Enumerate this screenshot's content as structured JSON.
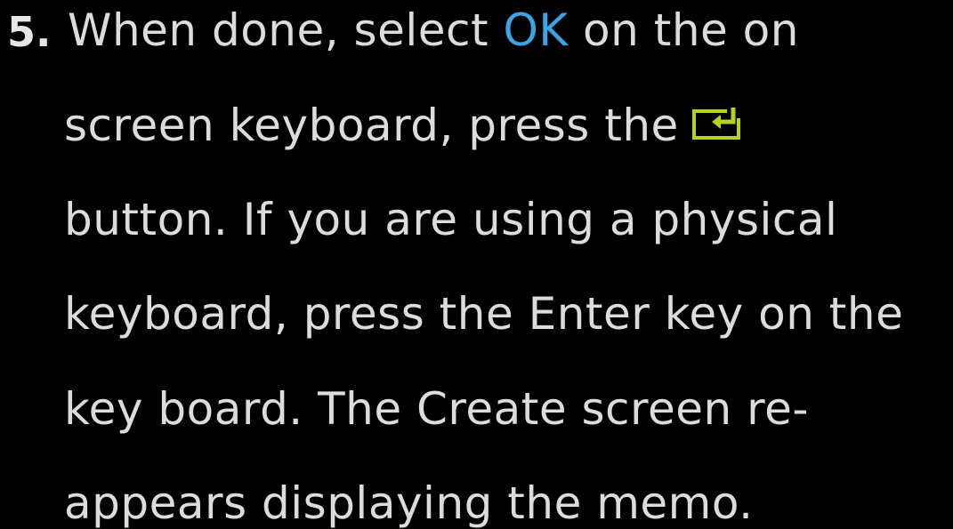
{
  "step": {
    "number": "5.",
    "lines": {
      "line1_before": "When done, select ",
      "line1_highlight": "OK",
      "line1_after": " on the on",
      "line2": "screen keyboard, press the",
      "line3": "button. If you are using a physical",
      "line4": "keyboard, press the Enter key on the",
      "line5": "key board. The Create screen re-",
      "line6": "appears displaying the memo."
    },
    "icon": "enter-key-icon",
    "colors": {
      "background": "#000000",
      "text": "#dcdcdc",
      "highlight": "#3aa6e6",
      "icon": "#b4d21e"
    }
  }
}
